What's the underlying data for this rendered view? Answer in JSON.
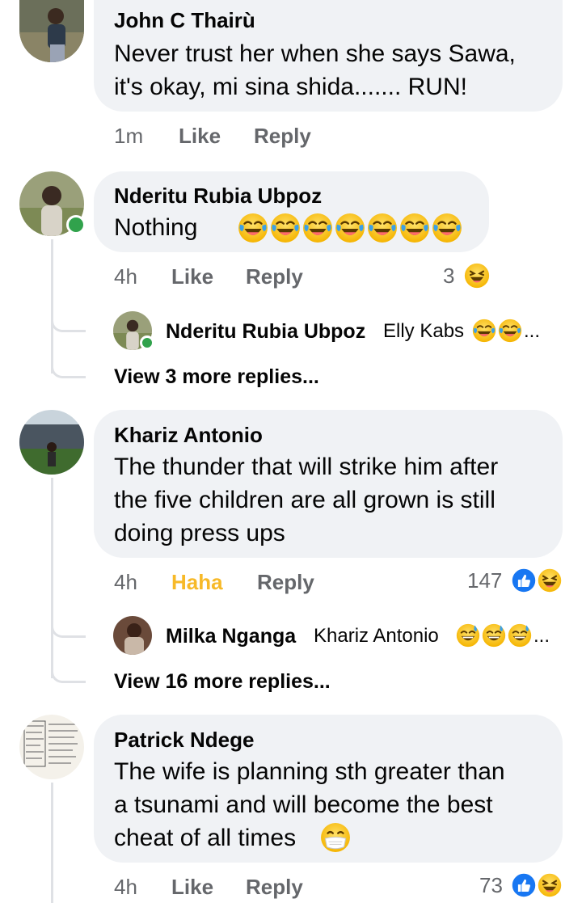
{
  "comments": [
    {
      "author": "John C Thairù",
      "text_lines": [
        "Never trust her when she says Sawa,",
        "it's okay, mi sina shida....... RUN!"
      ],
      "time": "1m",
      "like": "Like",
      "reply": "Reply"
    },
    {
      "author": "Nderitu Rubia Ubpoz",
      "text_lines": [
        "Nothing"
      ],
      "time": "4h",
      "like": "Like",
      "reply": "Reply",
      "reaction_count": "3",
      "reply_preview": {
        "author": "Nderitu Rubia Ubpoz",
        "snippet": "Elly Kabs",
        "ellipsis": "..."
      },
      "view_more": "View 3 more replies..."
    },
    {
      "author": "Khariz Antonio",
      "text_lines": [
        "The thunder that will strike him after",
        "the five children are all grown is still",
        "doing press ups"
      ],
      "time": "4h",
      "like": "Haha",
      "reply": "Reply",
      "reaction_count": "147",
      "reply_preview": {
        "author": "Milka Nganga",
        "snippet": "Khariz Antonio",
        "ellipsis": "..."
      },
      "view_more": "View 16 more replies..."
    },
    {
      "author": "Patrick Ndege",
      "text_lines": [
        "The wife is planning sth greater than",
        "a tsunami and will become the best",
        "cheat of all times"
      ],
      "time": "4h",
      "like": "Like",
      "reply": "Reply",
      "reaction_count": "73"
    }
  ],
  "colors": {
    "bubble": "#f0f2f5",
    "secondary_text": "#65676b",
    "haha_active": "#f7b928",
    "like_blue": "#1877f2",
    "online_green": "#31a24c"
  },
  "icons": [
    "tears-of-joy-emoji",
    "laughing-emoji",
    "sweat-smile-emoji",
    "mask-emoji",
    "like-reaction-icon",
    "haha-reaction-icon"
  ]
}
